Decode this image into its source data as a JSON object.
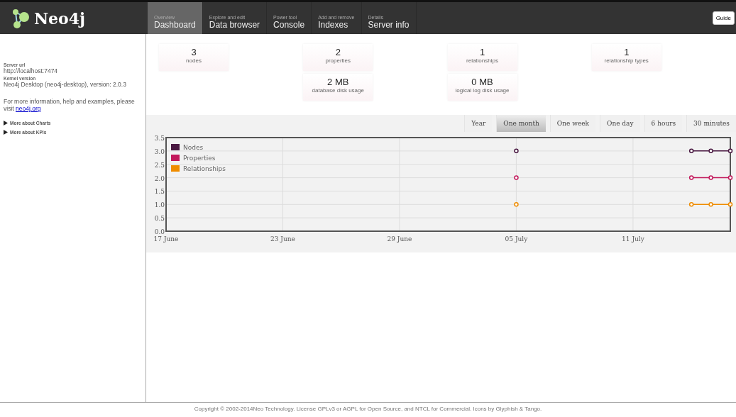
{
  "header": {
    "logo": "Neo4j",
    "tabs": [
      {
        "caption": "Overview",
        "label": "Dashboard",
        "selected": true
      },
      {
        "caption": "Explore and edit",
        "label": "Data browser",
        "selected": false
      },
      {
        "caption": "Power tool",
        "label": "Console",
        "selected": false
      },
      {
        "caption": "Add and remove",
        "label": "Indexes",
        "selected": false
      },
      {
        "caption": "Details",
        "label": "Server info",
        "selected": false
      }
    ],
    "guide_button": "Guide"
  },
  "sidebar": {
    "info": [
      {
        "label": "Server url",
        "value": "http://localhost:7474"
      },
      {
        "label": "Kernel version",
        "value": "Neo4j Desktop (neo4j-desktop), version: 2.0.3"
      }
    ],
    "help_text": "For more information, help and examples, please visit",
    "help_link": "neo4j.org",
    "toggles": [
      {
        "label": "More about Charts",
        "expanded": false
      },
      {
        "label": "More about KPIs",
        "expanded": false
      }
    ]
  },
  "stats": [
    [
      {
        "value": "3",
        "label": "nodes"
      }
    ],
    [
      {
        "value": "2",
        "label": "properties"
      },
      {
        "value": "2 MB",
        "label": "database disk usage"
      }
    ],
    [
      {
        "value": "1",
        "label": "relationships"
      },
      {
        "value": "0 MB",
        "label": "logical log disk usage"
      }
    ],
    [
      {
        "value": "1",
        "label": "relationship types"
      }
    ]
  ],
  "ranges": [
    {
      "label": "Year",
      "selected": false
    },
    {
      "label": "One month",
      "selected": true
    },
    {
      "label": "One week",
      "selected": false
    },
    {
      "label": "One day",
      "selected": false
    },
    {
      "label": "6 hours",
      "selected": false
    },
    {
      "label": "30 minutes",
      "selected": false
    }
  ],
  "chart_data": {
    "type": "line",
    "categories": [
      "17 June",
      null,
      null,
      null,
      null,
      null,
      "23 June",
      null,
      null,
      null,
      null,
      null,
      "29 June",
      null,
      null,
      null,
      null,
      null,
      "05 July",
      null,
      null,
      null,
      null,
      null,
      "11 July",
      null,
      null,
      null,
      null,
      null
    ],
    "series": [
      {
        "name": "Nodes",
        "color": "#4a1942",
        "marker": "circle",
        "values": [
          null,
          null,
          null,
          null,
          null,
          null,
          null,
          null,
          null,
          null,
          null,
          null,
          null,
          null,
          null,
          null,
          null,
          null,
          3,
          null,
          null,
          null,
          null,
          null,
          null,
          null,
          null,
          3,
          3,
          3
        ]
      },
      {
        "name": "Properties",
        "color": "#c2185b",
        "marker": "circle",
        "values": [
          null,
          null,
          null,
          null,
          null,
          null,
          null,
          null,
          null,
          null,
          null,
          null,
          null,
          null,
          null,
          null,
          null,
          null,
          2,
          null,
          null,
          null,
          null,
          null,
          null,
          null,
          null,
          2,
          2,
          2
        ]
      },
      {
        "name": "Relationships",
        "color": "#ef8c00",
        "marker": "circle",
        "values": [
          null,
          null,
          null,
          null,
          null,
          null,
          null,
          null,
          null,
          null,
          null,
          null,
          null,
          null,
          null,
          null,
          null,
          null,
          1,
          null,
          null,
          null,
          null,
          null,
          null,
          null,
          null,
          1,
          1,
          1
        ]
      }
    ],
    "ylim": [
      0,
      3.5
    ],
    "grid": true,
    "legend": true,
    "yticks": [
      {
        "value": 0,
        "label": "0.0"
      },
      {
        "value": 0.5,
        "label": "0.5"
      },
      {
        "value": 1,
        "label": "1.0"
      },
      {
        "value": 1.5,
        "label": "1.5"
      },
      {
        "value": 2,
        "label": "2.0"
      },
      {
        "value": 2.5,
        "label": "2.5"
      },
      {
        "value": 3,
        "label": "3.0"
      },
      {
        "value": 3.5,
        "label": "3.5"
      }
    ]
  },
  "footer": "Copyright © 2002-2014Neo Technology.  License GPLv3 or AGPL for Open Source, and NTCL for Commercial.  Icons by Glyphish & Tango."
}
